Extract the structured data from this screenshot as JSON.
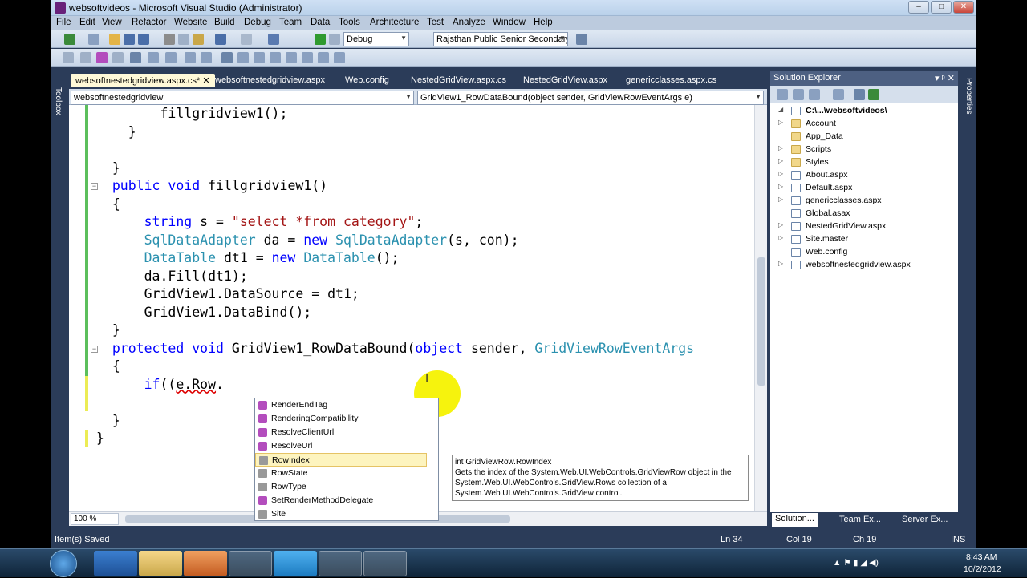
{
  "window": {
    "title": "websoftvideos - Microsoft Visual Studio (Administrator)",
    "min_glyph": "–",
    "max_glyph": "□",
    "close_glyph": "✕"
  },
  "menu": [
    "File",
    "Edit",
    "View",
    "Refactor",
    "Website",
    "Build",
    "Debug",
    "Team",
    "Data",
    "Tools",
    "Architecture",
    "Test",
    "Analyze",
    "Window",
    "Help"
  ],
  "toolbar": {
    "config": "Debug",
    "project": "Rajsthan Public Senior Secondary"
  },
  "left_tool": "Toolbox",
  "right_tool": "Properties",
  "tabs": [
    {
      "label": "websoftnestedgridview.aspx.cs*",
      "close": "✕"
    },
    {
      "label": "websoftnestedgridview.aspx"
    },
    {
      "label": "Web.config"
    },
    {
      "label": "NestedGridView.aspx.cs"
    },
    {
      "label": "NestedGridView.aspx"
    },
    {
      "label": "genericclasses.aspx.cs"
    }
  ],
  "nav": {
    "class_dropdown": "websoftnestedgridview",
    "member_dropdown": "GridView1_RowDataBound(object sender, GridViewRowEventArgs e)"
  },
  "code": {
    "l1": "fillgridview1();",
    "l2": "}",
    "l3": "}",
    "l4_kw1": "public",
    "l4_kw2": "void",
    "l4_rest": "fillgridview1()",
    "l5": "{",
    "l6_kw": "string",
    "l6_mid": "s = ",
    "l6_str": "\"select *from category\"",
    "l6_end": ";",
    "l7_ty": "SqlDataAdapter",
    "l7_mid": "da = ",
    "l7_kw": "new",
    "l7_ty2": "SqlDataAdapter",
    "l7_end": "(s, con);",
    "l8_ty": "DataTable",
    "l8_mid": "dt1 = ",
    "l8_kw": "new",
    "l8_ty2": "DataTable",
    "l8_end": "();",
    "l9": "da.Fill(dt1);",
    "l10": "GridView1.DataSource = dt1;",
    "l11": "GridView1.DataBind();",
    "l12": "}",
    "l13_kw1": "protected",
    "l13_kw2": "void",
    "l13_mid": "GridView1_RowDataBound(",
    "l13_kw3": "object",
    "l13_mid2": "sender, ",
    "l13_ty": "GridViewRowEventArgs",
    "l14": "{",
    "l15_kw": "if",
    "l15_mid": "((",
    "l15_sq": "e.Row",
    "l15_end": ".",
    "l16": "}",
    "l17": "}",
    "collapse_glyph": "−",
    "ibeam": "I"
  },
  "completion": {
    "items": [
      {
        "label": "RenderEndTag",
        "kind": "method"
      },
      {
        "label": "RenderingCompatibility",
        "kind": "method"
      },
      {
        "label": "ResolveClientUrl",
        "kind": "method"
      },
      {
        "label": "ResolveUrl",
        "kind": "method"
      },
      {
        "label": "RowIndex",
        "kind": "property"
      },
      {
        "label": "RowState",
        "kind": "property"
      },
      {
        "label": "RowType",
        "kind": "property"
      },
      {
        "label": "SetRenderMethodDelegate",
        "kind": "method"
      },
      {
        "label": "Site",
        "kind": "property"
      }
    ],
    "selected": "RowIndex"
  },
  "tooltip": {
    "line1": "int GridViewRow.RowIndex",
    "line2": "Gets the index of the System.Web.UI.WebControls.GridViewRow object in the",
    "line3": "System.Web.UI.WebControls.GridView.Rows collection of a",
    "line4": "System.Web.UI.WebControls.GridView control."
  },
  "solution_explorer": {
    "title": "Solution Explorer",
    "pin_glyph": "▾ ᵖ ✕",
    "root": "C:\\...\\websoftvideos\\",
    "items": [
      {
        "label": "Account",
        "type": "folder",
        "expand": "▷"
      },
      {
        "label": "App_Data",
        "type": "folder",
        "expand": ""
      },
      {
        "label": "Scripts",
        "type": "folder",
        "expand": "▷"
      },
      {
        "label": "Styles",
        "type": "folder",
        "expand": "▷"
      },
      {
        "label": "About.aspx",
        "type": "file",
        "expand": "▷"
      },
      {
        "label": "Default.aspx",
        "type": "file",
        "expand": "▷"
      },
      {
        "label": "genericclasses.aspx",
        "type": "file",
        "expand": "▷"
      },
      {
        "label": "Global.asax",
        "type": "file",
        "expand": ""
      },
      {
        "label": "NestedGridView.aspx",
        "type": "file",
        "expand": "▷"
      },
      {
        "label": "Site.master",
        "type": "file",
        "expand": "▷"
      },
      {
        "label": "Web.config",
        "type": "file",
        "expand": ""
      },
      {
        "label": "websoftnestedgridview.aspx",
        "type": "file",
        "expand": "▷"
      }
    ],
    "bottom_tabs": [
      "Solution...",
      "Team Ex...",
      "Server Ex..."
    ]
  },
  "editor": {
    "zoom": "100 %"
  },
  "status": {
    "message": "Item(s) Saved",
    "ln": "Ln 34",
    "col": "Col 19",
    "ch": "Ch 19",
    "mode": "INS"
  },
  "tray": {
    "time": "8:43 AM",
    "date": "10/2/2012",
    "icons": "▲ ⚑ ▮ ◢ ◀)"
  },
  "colors": {
    "keyword": "#0000ff",
    "type": "#2b91af",
    "string": "#a31515",
    "vs_frame": "#2b3c59"
  }
}
